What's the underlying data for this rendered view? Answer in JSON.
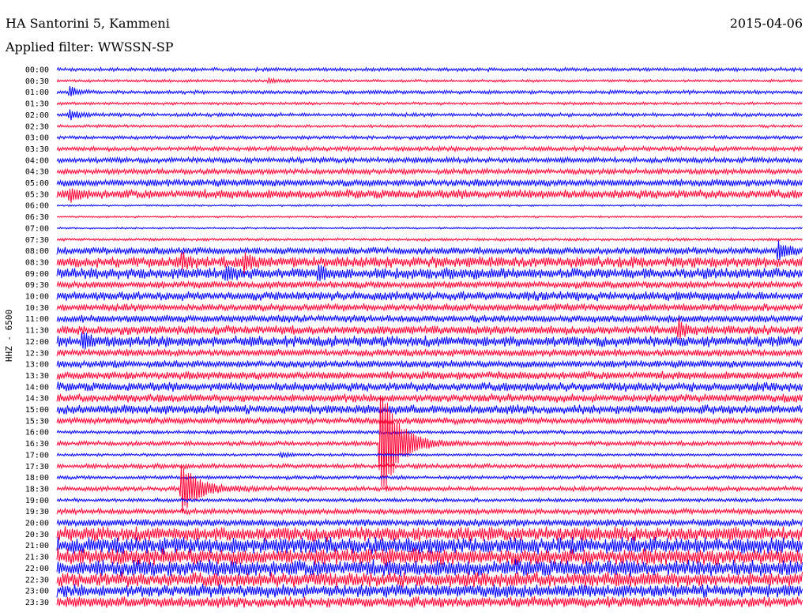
{
  "header": {
    "station": "HA Santorini 5, Kammeni",
    "date": "2015-04-06",
    "filter": "Applied filter: WWSSN-SP"
  },
  "chart_data": {
    "type": "line",
    "plot_kind": "helicorder",
    "ylabel": "HHZ - 6500",
    "row_labels": [
      "00:00",
      "00:30",
      "01:00",
      "01:30",
      "02:00",
      "02:30",
      "03:00",
      "03:30",
      "04:00",
      "04:30",
      "05:00",
      "05:30",
      "06:00",
      "06:30",
      "07:00",
      "07:30",
      "08:00",
      "08:30",
      "09:00",
      "09:30",
      "10:00",
      "10:30",
      "11:00",
      "11:30",
      "12:00",
      "12:30",
      "13:00",
      "13:30",
      "14:00",
      "14:30",
      "15:00",
      "15:30",
      "16:00",
      "16:30",
      "17:00",
      "17:30",
      "18:00",
      "18:30",
      "19:00",
      "19:30",
      "20:00",
      "20:30",
      "21:00",
      "21:30",
      "22:00",
      "22:30",
      "23:00",
      "23:30"
    ],
    "row_duration_minutes": 30,
    "colors": [
      "#0000ff",
      "#ff0033"
    ],
    "noise_amplitude": [
      2,
      1.5,
      2,
      1.5,
      2,
      1.5,
      2,
      2.5,
      3,
      3,
      4,
      5,
      1,
      1,
      1,
      1.5,
      4,
      6,
      6,
      4,
      5,
      4,
      4,
      5,
      6,
      4,
      4,
      4.5,
      5,
      4.5,
      5,
      3.5,
      2,
      2.5,
      1.5,
      2.5,
      2,
      2.5,
      2,
      3,
      4,
      8,
      9,
      9,
      9,
      8,
      7,
      6
    ],
    "events": [
      {
        "row": "00:30",
        "minute": 8.5,
        "amplitude": 3
      },
      {
        "row": "01:00",
        "minute": 0.5,
        "amplitude": 7
      },
      {
        "row": "02:00",
        "minute": 0.5,
        "amplitude": 6
      },
      {
        "row": "05:30",
        "minute": 0.5,
        "amplitude": 8
      },
      {
        "row": "08:00",
        "minute": 29,
        "amplitude": 12
      },
      {
        "row": "08:30",
        "minute": 5,
        "amplitude": 8
      },
      {
        "row": "08:30",
        "minute": 7.5,
        "amplitude": 10
      },
      {
        "row": "09:00",
        "minute": 6.8,
        "amplitude": 8
      },
      {
        "row": "09:00",
        "minute": 10.5,
        "amplitude": 10
      },
      {
        "row": "11:30",
        "minute": 25,
        "amplitude": 12
      },
      {
        "row": "12:00",
        "minute": 1,
        "amplitude": 10
      },
      {
        "row": "16:30",
        "minute": 13,
        "amplitude": 80
      },
      {
        "row": "17:00",
        "minute": 9,
        "amplitude": 3
      },
      {
        "row": "18:30",
        "minute": 5,
        "amplitude": 34
      }
    ]
  }
}
